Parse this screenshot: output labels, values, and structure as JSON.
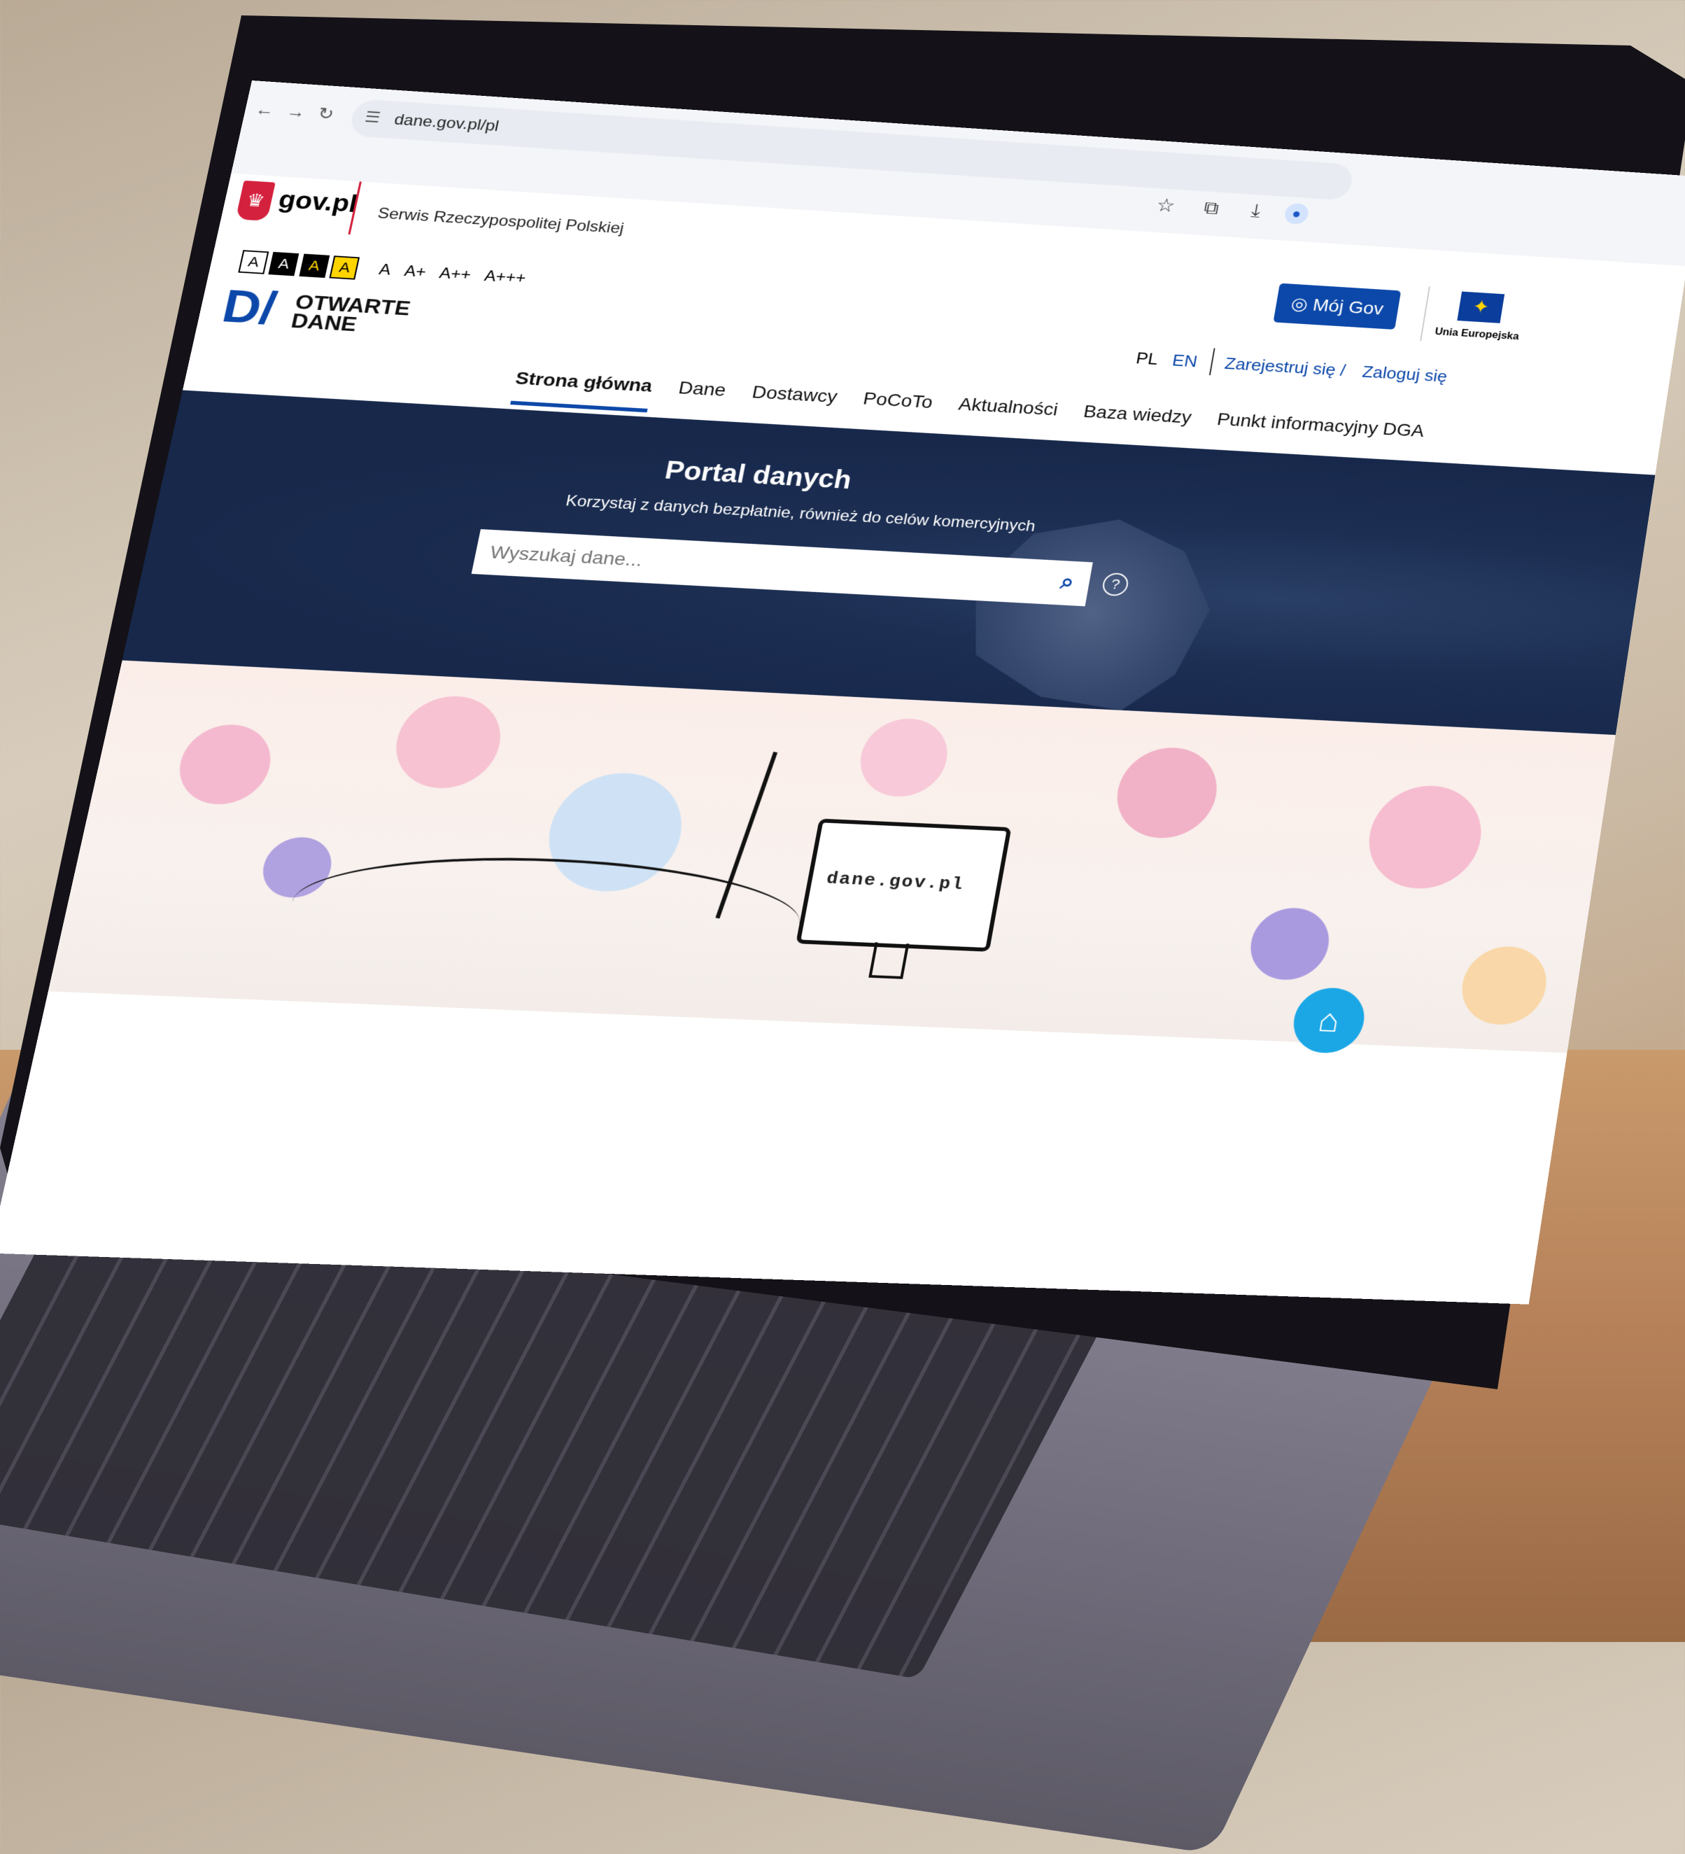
{
  "browser": {
    "url": "dane.gov.pl/pl",
    "back": "←",
    "forward": "→",
    "reload": "↻"
  },
  "gov": {
    "logo_text": "gov.pl",
    "tagline": "Serwis Rzeczypospolitej Polskiej"
  },
  "accessibility": {
    "contrast_options": [
      "A",
      "A",
      "A",
      "A"
    ],
    "font_sizes": [
      "A",
      "A+",
      "A++",
      "A+++"
    ]
  },
  "header": {
    "moj_gov": "Mój Gov",
    "eu_label": "Unia Europejska",
    "brand_line1": "OTWARTE",
    "brand_line2": "DANE",
    "lang_pl": "PL",
    "lang_en": "EN",
    "register": "Zarejestruj się /",
    "login": "Zaloguj się"
  },
  "nav": {
    "items": [
      {
        "label": "Strona główna",
        "active": true
      },
      {
        "label": "Dane"
      },
      {
        "label": "Dostawcy"
      },
      {
        "label": "PoCoTo"
      },
      {
        "label": "Aktualności"
      },
      {
        "label": "Baza wiedzy"
      },
      {
        "label": "Punkt informacyjny DGA"
      }
    ]
  },
  "hero": {
    "title": "Portal danych",
    "subtitle": "Korzystaj z danych bezpłatnie, również do celów komercyjnych",
    "search_placeholder": "Wyszukaj dane..."
  },
  "banner": {
    "monitor_text": "dane.gov.pl"
  },
  "colors": {
    "brand_blue": "#0c48a9",
    "hero_bg": "#1c2e52",
    "gov_red": "#d4213d",
    "fab": "#1ba7e6"
  },
  "icons": {
    "star": "☆",
    "extension": "⧉",
    "download": "⤓",
    "profile": "●",
    "search": "🔍",
    "help": "?",
    "user": "◎",
    "graduation": "🎓"
  }
}
